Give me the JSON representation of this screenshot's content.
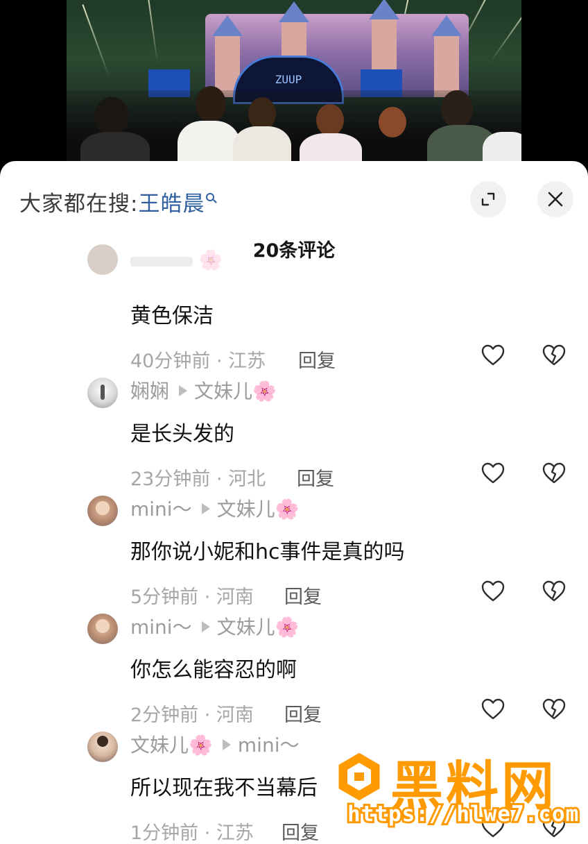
{
  "video": {
    "screen_text": "ZUUP"
  },
  "header": {
    "search_prefix": "大家都在搜:",
    "search_term": "王皓晨",
    "comment_count": "20条评论"
  },
  "comments": [
    {
      "author": "",
      "target": "",
      "text": "黄色保洁",
      "time_location": "40分钟前 · 江苏",
      "reply": "回复"
    },
    {
      "author": "娴娴",
      "target": "文妹儿",
      "target_emoji": "🌸",
      "text": "是长头发的",
      "time_location": "23分钟前 · 河北",
      "reply": "回复"
    },
    {
      "author": "mini～",
      "target": "文妹儿",
      "target_emoji": "🌸",
      "text": "那你说小妮和hc事件是真的吗",
      "time_location": "5分钟前 · 河南",
      "reply": "回复"
    },
    {
      "author": "mini～",
      "target": "文妹儿",
      "target_emoji": "🌸",
      "text": "你怎么能容忍的啊",
      "time_location": "2分钟前 · 河南",
      "reply": "回复"
    },
    {
      "author": "文妹儿",
      "author_emoji": "🌸",
      "target": "mini～",
      "text": "所以现在我不当幕后",
      "time_location": "1分钟前 · 江苏",
      "reply": "回复"
    }
  ],
  "watermark": {
    "title": "黑料网",
    "url": "https://hlwe7.com"
  },
  "colors": {
    "accent": "#2f5f9e",
    "watermark": "#ff9a00"
  }
}
